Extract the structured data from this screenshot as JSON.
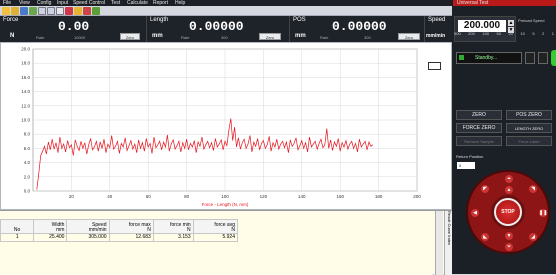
{
  "menu": {
    "items": [
      "File",
      "View",
      "Config",
      "Input",
      "Speed Control",
      "Test",
      "Calculate",
      "Report",
      "Help"
    ]
  },
  "window_title": "Universal Test",
  "readouts": [
    {
      "title": "Force",
      "value": "0.00",
      "unit": "N",
      "mini_label": "Rate",
      "mini_value": "10000",
      "button": "Zero"
    },
    {
      "title": "Length",
      "value": "0.00000",
      "unit": "mm",
      "mini_label": "Rate",
      "mini_value": "300",
      "button": "Zero"
    },
    {
      "title": "POS",
      "value": "0.00000",
      "unit": "mm",
      "mini_label": "Rate",
      "mini_value": "300",
      "button": "Zero"
    }
  ],
  "speed": {
    "title": "Speed",
    "value": "200.000",
    "unit": "mm/min",
    "preset_label": "Preload Speed",
    "presets": [
      "500",
      "200",
      "100",
      "50",
      "20",
      "10",
      "5",
      "2",
      "1"
    ]
  },
  "chart_data": {
    "type": "line",
    "xlabel": "Force - Length   (N, mm)",
    "ylabel": "",
    "xlim": [
      0,
      200
    ],
    "ylim": [
      0,
      20
    ],
    "x_ticks": [
      20,
      40,
      60,
      80,
      100,
      120,
      140,
      160,
      180,
      200
    ],
    "y_ticks": [
      "20.0",
      "18.0",
      "16.0",
      "14.0",
      "12.0",
      "10.0",
      "8.0",
      "6.0",
      "4.0",
      "2.0",
      "0.0"
    ],
    "grid": true,
    "color": "#e8121b",
    "series": [
      {
        "x_start": 2,
        "x_end": 177,
        "points": [
          [
            2,
            0.2
          ],
          [
            3,
            2.5
          ],
          [
            4,
            5.0
          ],
          [
            5,
            5.6
          ],
          [
            6,
            6.3
          ],
          [
            7,
            5.2
          ],
          [
            8,
            6.9
          ],
          [
            9,
            5.8
          ],
          [
            10,
            7.3
          ],
          [
            11,
            5.9
          ],
          [
            12,
            6.8
          ],
          [
            13,
            5.4
          ],
          [
            14,
            7.6
          ],
          [
            15,
            6.0
          ],
          [
            16,
            6.6
          ],
          [
            17,
            5.5
          ],
          [
            18,
            7.1
          ],
          [
            19,
            6.1
          ],
          [
            20,
            6.5
          ],
          [
            21,
            5.0
          ],
          [
            22,
            7.2
          ],
          [
            23,
            6.3
          ],
          [
            24,
            5.7
          ],
          [
            25,
            7.0
          ],
          [
            26,
            6.0
          ],
          [
            27,
            6.8
          ],
          [
            28,
            5.2
          ],
          [
            29,
            6.5
          ],
          [
            30,
            7.4
          ],
          [
            31,
            5.8
          ],
          [
            32,
            6.2
          ],
          [
            33,
            7.0
          ],
          [
            34,
            5.6
          ],
          [
            35,
            6.9
          ],
          [
            36,
            6.0
          ],
          [
            37,
            7.3
          ],
          [
            38,
            5.4
          ],
          [
            39,
            6.6
          ],
          [
            40,
            6.1
          ],
          [
            41,
            7.8
          ],
          [
            42,
            5.9
          ],
          [
            43,
            6.3
          ],
          [
            44,
            7.0
          ],
          [
            45,
            5.3
          ],
          [
            46,
            6.7
          ],
          [
            47,
            6.2
          ],
          [
            48,
            7.5
          ],
          [
            49,
            5.7
          ],
          [
            50,
            6.4
          ],
          [
            51,
            7.1
          ],
          [
            52,
            5.9
          ],
          [
            53,
            6.6
          ],
          [
            54,
            5.4
          ],
          [
            55,
            7.2
          ],
          [
            56,
            6.0
          ],
          [
            57,
            6.8
          ],
          [
            58,
            5.6
          ],
          [
            59,
            7.4
          ],
          [
            60,
            6.2
          ],
          [
            61,
            6.7
          ],
          [
            62,
            5.3
          ],
          [
            63,
            7.6
          ],
          [
            64,
            6.1
          ],
          [
            65,
            6.5
          ],
          [
            66,
            7.0
          ],
          [
            67,
            5.8
          ],
          [
            68,
            6.9
          ],
          [
            69,
            6.2
          ],
          [
            70,
            7.9
          ],
          [
            71,
            5.6
          ],
          [
            72,
            6.6
          ],
          [
            73,
            7.2
          ],
          [
            74,
            5.9
          ],
          [
            75,
            6.4
          ],
          [
            76,
            7.0
          ],
          [
            77,
            5.5
          ],
          [
            78,
            6.8
          ],
          [
            79,
            6.0
          ],
          [
            80,
            7.3
          ],
          [
            81,
            5.8
          ],
          [
            82,
            6.7
          ],
          [
            83,
            6.2
          ],
          [
            84,
            7.1
          ],
          [
            85,
            5.4
          ],
          [
            86,
            6.9
          ],
          [
            87,
            6.3
          ],
          [
            88,
            7.6
          ],
          [
            89,
            5.9
          ],
          [
            90,
            6.5
          ],
          [
            91,
            7.0
          ],
          [
            92,
            6.1
          ],
          [
            93,
            6.8
          ],
          [
            94,
            5.7
          ],
          [
            95,
            7.4
          ],
          [
            96,
            6.2
          ],
          [
            97,
            6.6
          ],
          [
            98,
            7.2
          ],
          [
            99,
            5.8
          ],
          [
            100,
            7.0
          ],
          [
            101,
            6.4
          ],
          [
            102,
            8.5
          ],
          [
            103,
            10.2
          ],
          [
            104,
            7.1
          ],
          [
            105,
            9.0
          ],
          [
            106,
            6.2
          ],
          [
            107,
            7.5
          ],
          [
            108,
            5.9
          ],
          [
            109,
            6.8
          ],
          [
            110,
            7.3
          ],
          [
            111,
            6.0
          ],
          [
            112,
            6.6
          ],
          [
            113,
            7.8
          ],
          [
            114,
            5.5
          ],
          [
            115,
            6.9
          ],
          [
            116,
            6.3
          ],
          [
            117,
            7.4
          ],
          [
            118,
            5.8
          ],
          [
            119,
            6.7
          ],
          [
            120,
            7.1
          ],
          [
            121,
            6.0
          ],
          [
            122,
            6.5
          ],
          [
            123,
            7.7
          ],
          [
            124,
            5.6
          ],
          [
            125,
            6.8
          ],
          [
            126,
            6.2
          ],
          [
            127,
            7.3
          ],
          [
            128,
            5.9
          ],
          [
            129,
            6.6
          ],
          [
            130,
            7.0
          ],
          [
            131,
            6.1
          ],
          [
            132,
            6.9
          ],
          [
            133,
            5.4
          ],
          [
            134,
            7.2
          ],
          [
            135,
            6.3
          ],
          [
            136,
            6.7
          ],
          [
            137,
            7.5
          ],
          [
            138,
            5.8
          ],
          [
            139,
            6.4
          ],
          [
            140,
            7.1
          ],
          [
            141,
            6.0
          ],
          [
            142,
            6.8
          ],
          [
            143,
            5.5
          ],
          [
            144,
            7.6
          ],
          [
            145,
            6.2
          ],
          [
            146,
            6.6
          ],
          [
            147,
            7.0
          ],
          [
            148,
            5.9
          ],
          [
            149,
            6.7
          ],
          [
            150,
            7.3
          ],
          [
            151,
            6.1
          ],
          [
            152,
            6.5
          ],
          [
            153,
            8.8
          ],
          [
            154,
            6.0
          ],
          [
            155,
            7.2
          ],
          [
            156,
            5.7
          ],
          [
            157,
            6.9
          ],
          [
            158,
            6.3
          ],
          [
            159,
            7.4
          ],
          [
            160,
            5.6
          ],
          [
            161,
            6.8
          ],
          [
            162,
            6.2
          ],
          [
            163,
            7.1
          ],
          [
            164,
            5.9
          ],
          [
            165,
            6.6
          ],
          [
            166,
            7.0
          ],
          [
            167,
            6.0
          ],
          [
            168,
            6.7
          ],
          [
            169,
            5.5
          ],
          [
            170,
            7.3
          ],
          [
            171,
            6.2
          ],
          [
            172,
            6.6
          ],
          [
            173,
            7.0
          ],
          [
            174,
            5.8
          ],
          [
            175,
            6.9
          ],
          [
            176,
            6.3
          ],
          [
            177,
            6.5
          ]
        ]
      }
    ]
  },
  "table": {
    "headers": [
      [
        "No",
        ""
      ],
      [
        "Width",
        "mm"
      ],
      [
        "Speed",
        "mm/min"
      ],
      [
        "force max",
        "N"
      ],
      [
        "force min",
        "N"
      ],
      [
        "force avg",
        "N"
      ]
    ],
    "rows": [
      [
        "1",
        "25.400",
        "305.000",
        "12.683",
        "3.153",
        "5.924"
      ]
    ]
  },
  "right_panel": {
    "status": "Standby...",
    "buttons": [
      {
        "label": "ZERO",
        "enabled": true
      },
      {
        "label": "POS ZERO",
        "enabled": true
      },
      {
        "label": "FORCE ZERO",
        "enabled": true
      },
      {
        "label": "LENGTH ZERO",
        "enabled": true
      },
      {
        "label": "Remove Sample",
        "enabled": false
      },
      {
        "label": "Force Latch",
        "enabled": false
      }
    ],
    "return_label": "Return Position",
    "return_value": "0",
    "stop_label": "STOP",
    "side_tabs": [
      "Result",
      "Curve",
      "Index"
    ]
  }
}
